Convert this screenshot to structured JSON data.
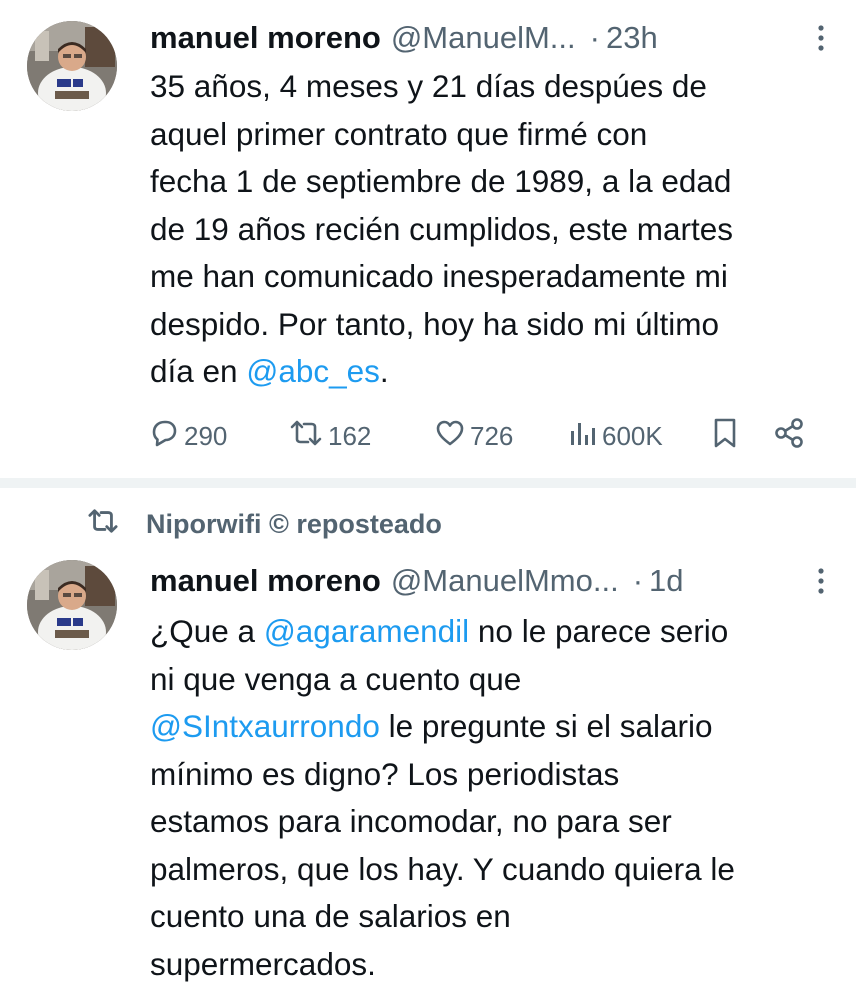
{
  "tweets": [
    {
      "author_name": "manuel moreno",
      "handle": "@ManuelM...",
      "dot": "·",
      "time": "23h",
      "text_parts": [
        "35 años, 4 meses y 21 días despúes de\naquel primer contrato que firmé con\nfecha 1 de septiembre de 1989, a la edad\nde 19 años recién cumplidos, este martes\nme han comunicado inesperadamente mi\ndespido. Por tanto, hoy ha sido mi último\ndía en ",
        "@abc_es",
        "."
      ],
      "actions": {
        "replies": "290",
        "reposts": "162",
        "likes": "726",
        "views": "600K"
      },
      "icons": [
        "reply-icon",
        "repost-icon",
        "like-icon",
        "views-icon",
        "bookmark-icon",
        "share-icon",
        "more-icon"
      ]
    },
    {
      "repost_by": "Niporwifi © reposteado",
      "author_name": "manuel moreno",
      "handle": "@ManuelMmo...",
      "dot": "·",
      "time": "1d",
      "text_parts": [
        "¿Que a ",
        "@agaramendil",
        " no le parece serio\nni que venga a cuento que\n",
        "@SIntxaurrondo",
        " le pregunte si el salario\nmínimo es digno? Los periodistas\nestamos para incomodar, no para ser\npalmeros, que los hay. Y cuando quiera le\ncuento una de salarios en\nsupermercados."
      ]
    }
  ],
  "colors": {
    "text": "#0f1419",
    "secondary": "#536471",
    "link": "#1d9bf0",
    "divider": "#eff3f4"
  }
}
